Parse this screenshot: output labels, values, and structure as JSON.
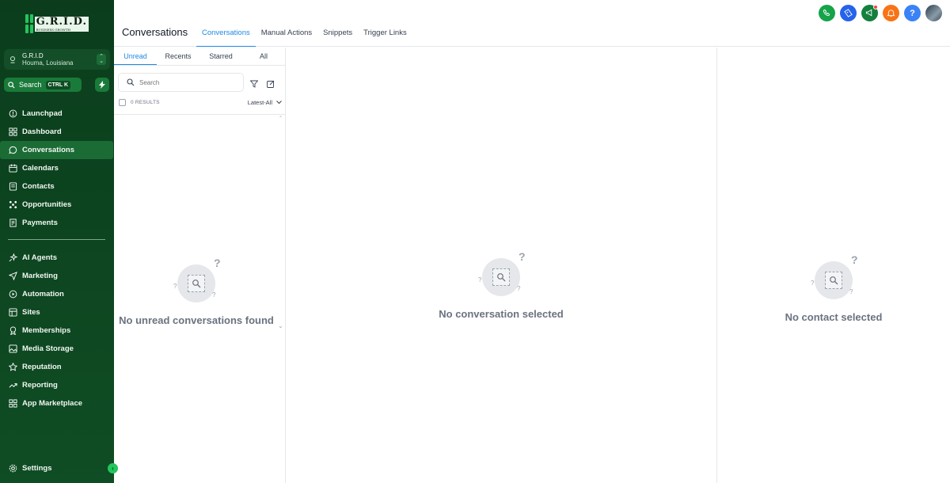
{
  "brand": {
    "logo_text": "G.R.I.D.",
    "logo_subtext": "BUSINESS GROWTH"
  },
  "account": {
    "name": "G.R.I.D",
    "location": "Houma, Louisiana"
  },
  "search": {
    "label": "Search",
    "shortcut": "CTRL K"
  },
  "sidebar": {
    "primary": [
      {
        "label": "Launchpad",
        "icon": "rocket-icon"
      },
      {
        "label": "Dashboard",
        "icon": "grid-icon"
      },
      {
        "label": "Conversations",
        "icon": "chat-icon",
        "active": true
      },
      {
        "label": "Calendars",
        "icon": "calendar-icon"
      },
      {
        "label": "Contacts",
        "icon": "contact-card-icon"
      },
      {
        "label": "Opportunities",
        "icon": "network-icon"
      },
      {
        "label": "Payments",
        "icon": "receipt-icon"
      }
    ],
    "secondary": [
      {
        "label": "AI Agents",
        "icon": "sparkle-icon"
      },
      {
        "label": "Marketing",
        "icon": "send-icon"
      },
      {
        "label": "Automation",
        "icon": "automation-icon"
      },
      {
        "label": "Sites",
        "icon": "globe-icon"
      },
      {
        "label": "Memberships",
        "icon": "award-icon"
      },
      {
        "label": "Media Storage",
        "icon": "image-icon"
      },
      {
        "label": "Reputation",
        "icon": "star-icon"
      },
      {
        "label": "Reporting",
        "icon": "trend-icon"
      },
      {
        "label": "App Marketplace",
        "icon": "apps-icon"
      }
    ],
    "settings_label": "Settings"
  },
  "header": {
    "title": "Conversations",
    "tabs": [
      {
        "label": "Conversations",
        "active": true
      },
      {
        "label": "Manual Actions"
      },
      {
        "label": "Snippets"
      },
      {
        "label": "Trigger Links"
      }
    ],
    "icons": [
      {
        "name": "phone-icon",
        "color": "#16a34a"
      },
      {
        "name": "ticket-icon",
        "color": "#2563eb"
      },
      {
        "name": "megaphone-icon",
        "color": "#15803d",
        "badge": true
      },
      {
        "name": "bell-icon",
        "color": "#f97316"
      },
      {
        "name": "help-icon",
        "color": "#3b82f6",
        "glyph": "?"
      }
    ]
  },
  "list": {
    "tabs": [
      "Unread",
      "Recents",
      "Starred",
      "All"
    ],
    "active_tab": "Unread",
    "search_placeholder": "Search",
    "results": "0 RESULTS",
    "sort": "Latest-All",
    "empty": "No unread conversations found"
  },
  "conversation": {
    "empty": "No conversation selected"
  },
  "contact": {
    "empty": "No contact selected"
  },
  "colors": {
    "sidebar_bg": "#0f4d24",
    "accent": "#1e88e5",
    "active_nav": "#1b6b35"
  }
}
